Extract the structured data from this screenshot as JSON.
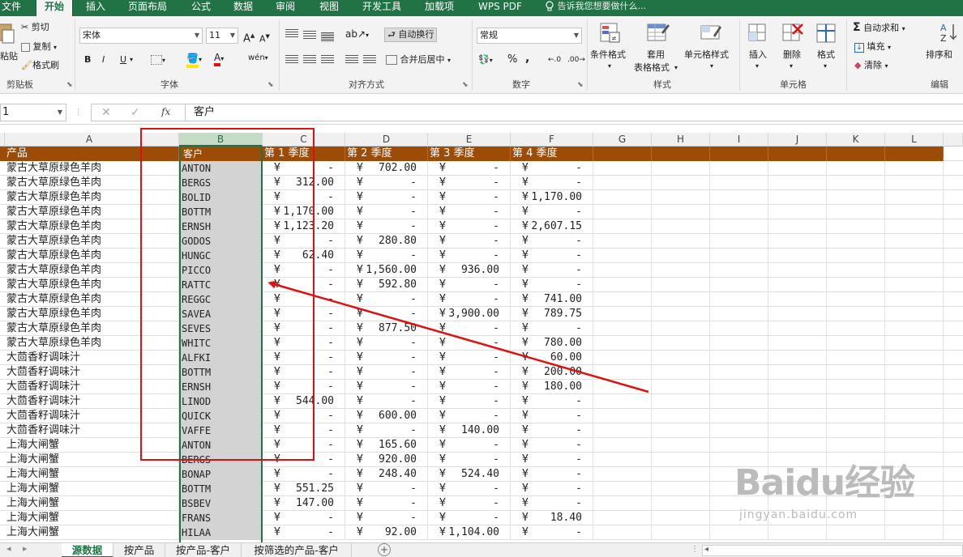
{
  "menu": {
    "tabs": [
      "文件",
      "开始",
      "插入",
      "页面布局",
      "公式",
      "数据",
      "审阅",
      "视图",
      "开发工具",
      "加载项",
      "WPS PDF"
    ],
    "tell_me": "告诉我您想要做什么..."
  },
  "ribbon": {
    "clipboard": {
      "paste": "粘贴",
      "cut": "剪切",
      "copy": "复制",
      "format_painter": "格式刷",
      "label": "剪贴板"
    },
    "font": {
      "name": "宋体",
      "size": "11",
      "bold": "B",
      "italic": "I",
      "underline": "U",
      "grow": "A",
      "shrink": "A",
      "label": "字体"
    },
    "alignment": {
      "wrap_text": "自动换行",
      "merge_center": "合并后居中",
      "label": "对齐方式"
    },
    "number": {
      "format": "常规",
      "percent": "%",
      "comma": ",",
      "label": "数字"
    },
    "styles": {
      "conditional": "条件格式",
      "table_format_line1": "套用",
      "table_format_line2": "表格格式",
      "cell_styles": "单元格样式",
      "label": "样式"
    },
    "cells": {
      "insert": "插入",
      "delete": "删除",
      "format": "格式",
      "label": "单元格"
    },
    "editing": {
      "autosum": "自动求和",
      "fill": "填充",
      "clear": "清除",
      "sort_filter": "排序和",
      "label": "编辑"
    }
  },
  "formula_bar": {
    "name_box": "1",
    "fx": "fx",
    "content": "客户"
  },
  "columns": [
    "A",
    "B",
    "C",
    "D",
    "E",
    "F",
    "G",
    "H",
    "I",
    "J",
    "K",
    "L"
  ],
  "selected_column": "B",
  "header_row": {
    "product": "产品",
    "customer": "客户",
    "q1": "第 1 季度",
    "q2": "第 2 季度",
    "q3": "第 3 季度",
    "q4": "第 4 季度"
  },
  "currency_symbol": "¥",
  "rows": [
    {
      "product": "蒙古大草原绿色羊肉",
      "customer": "ANTON",
      "q1": "-",
      "q2": "702.00",
      "q3": "-",
      "q4": "-"
    },
    {
      "product": "蒙古大草原绿色羊肉",
      "customer": "BERGS",
      "q1": "312.00",
      "q2": "-",
      "q3": "-",
      "q4": "-"
    },
    {
      "product": "蒙古大草原绿色羊肉",
      "customer": "BOLID",
      "q1": "-",
      "q2": "-",
      "q3": "-",
      "q4": "1,170.00"
    },
    {
      "product": "蒙古大草原绿色羊肉",
      "customer": "BOTTM",
      "q1": "1,170.00",
      "q2": "-",
      "q3": "-",
      "q4": "-"
    },
    {
      "product": "蒙古大草原绿色羊肉",
      "customer": "ERNSH",
      "q1": "1,123.20",
      "q2": "-",
      "q3": "-",
      "q4": "2,607.15"
    },
    {
      "product": "蒙古大草原绿色羊肉",
      "customer": "GODOS",
      "q1": "-",
      "q2": "280.80",
      "q3": "-",
      "q4": "-"
    },
    {
      "product": "蒙古大草原绿色羊肉",
      "customer": "HUNGC",
      "q1": "62.40",
      "q2": "-",
      "q3": "-",
      "q4": "-"
    },
    {
      "product": "蒙古大草原绿色羊肉",
      "customer": "PICCO",
      "q1": "-",
      "q2": "1,560.00",
      "q3": "936.00",
      "q4": "-"
    },
    {
      "product": "蒙古大草原绿色羊肉",
      "customer": "RATTC",
      "q1": "-",
      "q2": "592.80",
      "q3": "-",
      "q4": "-"
    },
    {
      "product": "蒙古大草原绿色羊肉",
      "customer": "REGGC",
      "q1": "-",
      "q2": "-",
      "q3": "-",
      "q4": "741.00"
    },
    {
      "product": "蒙古大草原绿色羊肉",
      "customer": "SAVEA",
      "q1": "-",
      "q2": "-",
      "q3": "3,900.00",
      "q4": "789.75"
    },
    {
      "product": "蒙古大草原绿色羊肉",
      "customer": "SEVES",
      "q1": "-",
      "q2": "877.50",
      "q3": "-",
      "q4": "-"
    },
    {
      "product": "蒙古大草原绿色羊肉",
      "customer": "WHITC",
      "q1": "-",
      "q2": "-",
      "q3": "-",
      "q4": "780.00"
    },
    {
      "product": "大茴香籽调味汁",
      "customer": "ALFKI",
      "q1": "-",
      "q2": "-",
      "q3": "-",
      "q4": "60.00"
    },
    {
      "product": "大茴香籽调味汁",
      "customer": "BOTTM",
      "q1": "-",
      "q2": "-",
      "q3": "-",
      "q4": "200.00"
    },
    {
      "product": "大茴香籽调味汁",
      "customer": "ERNSH",
      "q1": "-",
      "q2": "-",
      "q3": "-",
      "q4": "180.00"
    },
    {
      "product": "大茴香籽调味汁",
      "customer": "LINOD",
      "q1": "544.00",
      "q2": "-",
      "q3": "-",
      "q4": "-"
    },
    {
      "product": "大茴香籽调味汁",
      "customer": "QUICK",
      "q1": "-",
      "q2": "600.00",
      "q3": "-",
      "q4": "-"
    },
    {
      "product": "大茴香籽调味汁",
      "customer": "VAFFE",
      "q1": "-",
      "q2": "-",
      "q3": "140.00",
      "q4": "-"
    },
    {
      "product": "上海大闸蟹",
      "customer": "ANTON",
      "q1": "-",
      "q2": "165.60",
      "q3": "-",
      "q4": "-"
    },
    {
      "product": "上海大闸蟹",
      "customer": "BERGS",
      "q1": "-",
      "q2": "920.00",
      "q3": "-",
      "q4": "-"
    },
    {
      "product": "上海大闸蟹",
      "customer": "BONAP",
      "q1": "-",
      "q2": "248.40",
      "q3": "524.40",
      "q4": "-"
    },
    {
      "product": "上海大闸蟹",
      "customer": "BOTTM",
      "q1": "551.25",
      "q2": "-",
      "q3": "-",
      "q4": "-"
    },
    {
      "product": "上海大闸蟹",
      "customer": "BSBEV",
      "q1": "147.00",
      "q2": "-",
      "q3": "-",
      "q4": "-"
    },
    {
      "product": "上海大闸蟹",
      "customer": "FRANS",
      "q1": "-",
      "q2": "-",
      "q3": "-",
      "q4": "18.40"
    },
    {
      "product": "上海大闸蟹",
      "customer": "HILAA",
      "q1": "-",
      "q2": "92.00",
      "q3": "1,104.00",
      "q4": "-"
    }
  ],
  "sheet_tabs": [
    "源数据",
    "按产品",
    "按产品-客户",
    "按筛选的产品-客户"
  ],
  "active_sheet": "源数据",
  "watermark": {
    "brand": "Baidu经验",
    "url": "jingyan.baidu.com"
  },
  "colors": {
    "excel_green": "#217346",
    "header_fill": "#9c4c06",
    "annotation_red": "#e01010",
    "selected_column_fill": "#d3d3d3"
  }
}
